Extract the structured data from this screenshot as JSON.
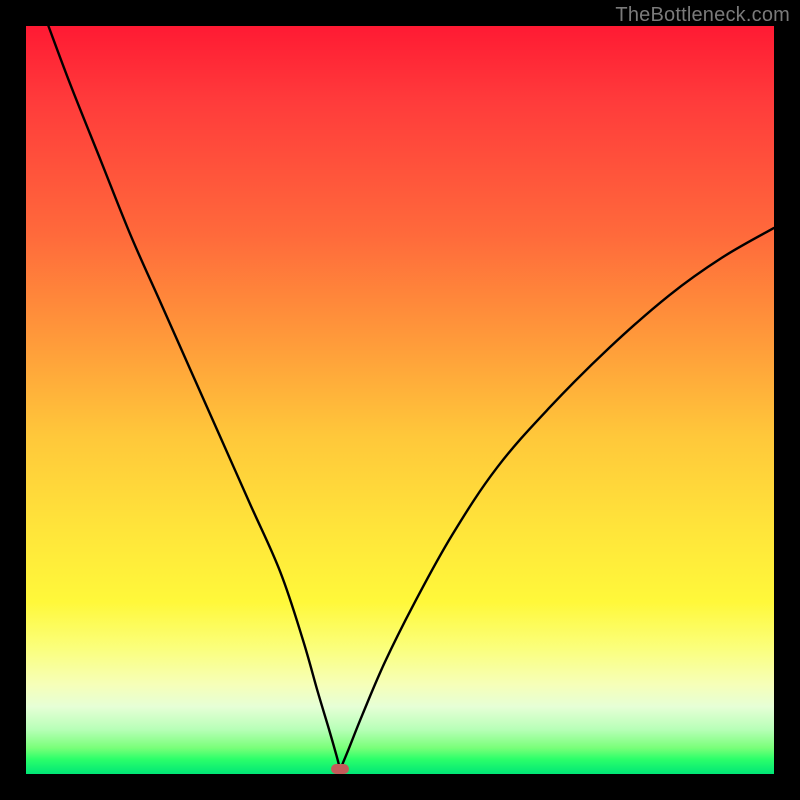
{
  "attribution": "TheBottleneck.com",
  "colors": {
    "frame": "#000000",
    "curve": "#000000",
    "marker": "#c45a5a",
    "gradient_stops": [
      "#ff1a33",
      "#ff3b3b",
      "#ff6a3b",
      "#ff9a3a",
      "#ffc83a",
      "#ffe43a",
      "#fff83a",
      "#fbff7a",
      "#f6ffb8",
      "#e6ffd6",
      "#b8ffb8",
      "#7aff7a",
      "#2cff6a",
      "#00e676"
    ]
  },
  "chart_data": {
    "type": "line",
    "title": "",
    "xlabel": "",
    "ylabel": "",
    "xlim": [
      0,
      100
    ],
    "ylim": [
      0,
      100
    ],
    "min_x": 42,
    "series": [
      {
        "name": "left-branch",
        "x": [
          3,
          6,
          10,
          14,
          18,
          22,
          26,
          30,
          34,
          37,
          39,
          40.5,
          41.5,
          42
        ],
        "y": [
          100,
          92,
          82,
          72,
          63,
          54,
          45,
          36,
          27,
          18,
          11,
          6,
          2.5,
          0.6
        ]
      },
      {
        "name": "right-branch",
        "x": [
          42,
          43,
          45,
          48,
          52,
          57,
          63,
          70,
          78,
          86,
          93,
          100
        ],
        "y": [
          0.6,
          3,
          8,
          15,
          23,
          32,
          41,
          49,
          57,
          64,
          69,
          73
        ]
      }
    ],
    "marker": {
      "x": 42,
      "y": 0.7
    }
  }
}
